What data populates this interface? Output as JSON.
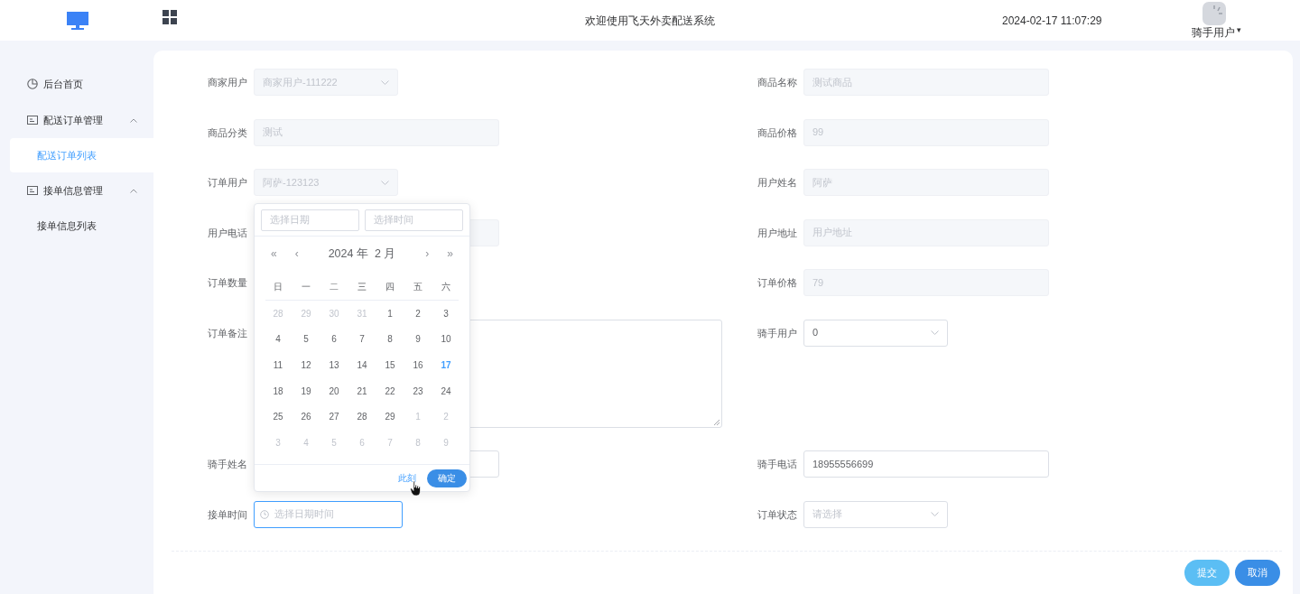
{
  "header": {
    "title": "欢迎使用飞天外卖配送系统",
    "datetime": "2024-02-17 11:07:29",
    "user": "骑手用户",
    "user_caret": "▾"
  },
  "sidebar": {
    "items": [
      {
        "label": "后台首页",
        "kind": "link"
      },
      {
        "label": "配送订单管理",
        "kind": "group",
        "expanded": true,
        "children": [
          {
            "label": "配送订单列表",
            "selected": true
          }
        ]
      },
      {
        "label": "接单信息管理",
        "kind": "group",
        "expanded": true,
        "children": [
          {
            "label": "接单信息列表",
            "selected": false
          }
        ]
      }
    ]
  },
  "form": {
    "rows": [
      {
        "left": {
          "label": "商家用户",
          "kind": "select",
          "value": "商家用户-111222",
          "disabled": true
        },
        "right": {
          "label": "商品名称",
          "kind": "input",
          "value": "测试商品",
          "disabled": true
        }
      },
      {
        "left": {
          "label": "商品分类",
          "kind": "input",
          "value": "测试",
          "disabled": true
        },
        "right": {
          "label": "商品价格",
          "kind": "input",
          "value": "99",
          "disabled": true
        }
      },
      {
        "left": {
          "label": "订单用户",
          "kind": "select",
          "value": "阿萨-123123",
          "disabled": true
        },
        "right": {
          "label": "用户姓名",
          "kind": "input",
          "value": "阿萨",
          "disabled": true
        }
      },
      {
        "left": {
          "label": "用户电话",
          "kind": "input",
          "disabled": true
        },
        "right": {
          "label": "用户地址",
          "kind": "input",
          "placeholder": "用户地址",
          "disabled": true
        }
      },
      {
        "left": {
          "label": "订单数量"
        },
        "right": {
          "label": "订单价格",
          "kind": "input",
          "value": "79",
          "disabled": true
        }
      },
      {
        "left": {
          "label": "订单备注",
          "kind": "textarea",
          "disabled": false
        },
        "right": {
          "label": "骑手用户",
          "kind": "select",
          "value": "0",
          "disabled": false
        }
      },
      {
        "left": {
          "label": "骑手姓名",
          "kind": "input",
          "disabled": false
        },
        "right": {
          "label": "骑手电话",
          "kind": "input",
          "value": "18955556699",
          "disabled": false
        }
      },
      {
        "left": {
          "label": "接单时间",
          "kind": "datetime",
          "placeholder": "选择日期时间",
          "focused": true,
          "disabled": false
        },
        "right": {
          "label": "订单状态",
          "kind": "select",
          "placeholder": "请选择",
          "disabled": false
        }
      }
    ],
    "buttons": [
      {
        "label": "提交",
        "kind": "submit"
      },
      {
        "label": "取消",
        "kind": "cancel"
      }
    ]
  },
  "date_picker": {
    "date_placeholder": "选择日期",
    "time_placeholder": "选择时间",
    "prev_year": "«",
    "prev_month": "‹",
    "title": "2024 年  2 月",
    "next_month": "›",
    "next_year": "»",
    "weekdays": [
      "日",
      "一",
      "二",
      "三",
      "四",
      "五",
      "六"
    ],
    "days": [
      {
        "day": "28",
        "other_month": true,
        "today": false
      },
      {
        "day": "29",
        "other_month": true,
        "today": false
      },
      {
        "day": "30",
        "other_month": true,
        "today": false
      },
      {
        "day": "31",
        "other_month": true,
        "today": false
      },
      {
        "day": "1",
        "other_month": false,
        "today": false
      },
      {
        "day": "2",
        "other_month": false,
        "today": false
      },
      {
        "day": "3",
        "other_month": false,
        "today": false
      },
      {
        "day": "4",
        "other_month": false,
        "today": false
      },
      {
        "day": "5",
        "other_month": false,
        "today": false
      },
      {
        "day": "6",
        "other_month": false,
        "today": false
      },
      {
        "day": "7",
        "other_month": false,
        "today": false
      },
      {
        "day": "8",
        "other_month": false,
        "today": false
      },
      {
        "day": "9",
        "other_month": false,
        "today": false
      },
      {
        "day": "10",
        "other_month": false,
        "today": false
      },
      {
        "day": "11",
        "other_month": false,
        "today": false
      },
      {
        "day": "12",
        "other_month": false,
        "today": false
      },
      {
        "day": "13",
        "other_month": false,
        "today": false
      },
      {
        "day": "14",
        "other_month": false,
        "today": false
      },
      {
        "day": "15",
        "other_month": false,
        "today": false
      },
      {
        "day": "16",
        "other_month": false,
        "today": false
      },
      {
        "day": "17",
        "other_month": false,
        "today": true
      },
      {
        "day": "18",
        "other_month": false,
        "today": false
      },
      {
        "day": "19",
        "other_month": false,
        "today": false
      },
      {
        "day": "20",
        "other_month": false,
        "today": false
      },
      {
        "day": "21",
        "other_month": false,
        "today": false
      },
      {
        "day": "22",
        "other_month": false,
        "today": false
      },
      {
        "day": "23",
        "other_month": false,
        "today": false
      },
      {
        "day": "24",
        "other_month": false,
        "today": false
      },
      {
        "day": "25",
        "other_month": false,
        "today": false
      },
      {
        "day": "26",
        "other_month": false,
        "today": false
      },
      {
        "day": "27",
        "other_month": false,
        "today": false
      },
      {
        "day": "28",
        "other_month": false,
        "today": false
      },
      {
        "day": "29",
        "other_month": false,
        "today": false
      },
      {
        "day": "1",
        "other_month": true,
        "today": false
      },
      {
        "day": "2",
        "other_month": true,
        "today": false
      },
      {
        "day": "3",
        "other_month": true,
        "today": false
      },
      {
        "day": "4",
        "other_month": true,
        "today": false
      },
      {
        "day": "5",
        "other_month": true,
        "today": false
      },
      {
        "day": "6",
        "other_month": true,
        "today": false
      },
      {
        "day": "7",
        "other_month": true,
        "today": false
      },
      {
        "day": "8",
        "other_month": true,
        "today": false
      },
      {
        "day": "9",
        "other_month": true,
        "today": false
      }
    ],
    "now_link": "此刻",
    "confirm": "确定"
  }
}
